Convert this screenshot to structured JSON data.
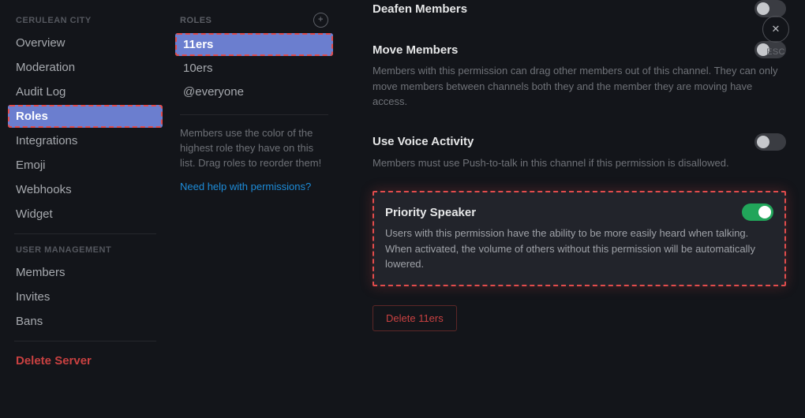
{
  "sidebar": {
    "category1": "CERULEAN CITY",
    "items1": [
      "Overview",
      "Moderation",
      "Audit Log",
      "Roles",
      "Integrations",
      "Emoji",
      "Webhooks",
      "Widget"
    ],
    "selected1": 3,
    "category2": "USER MANAGEMENT",
    "items2": [
      "Members",
      "Invites",
      "Bans"
    ],
    "delete_server": "Delete Server"
  },
  "roles": {
    "header": "ROLES",
    "list": [
      "11ers",
      "10ers",
      "@everyone"
    ],
    "selected": 0,
    "help_text": "Members use the color of the highest role they have on this list. Drag roles to reorder them!",
    "help_link": "Need help with permissions?"
  },
  "permissions": [
    {
      "title": "Deafen Members",
      "desc": "",
      "on": false
    },
    {
      "title": "Move Members",
      "desc": "Members with this permission can drag other members out of this channel. They can only move members between channels both they and the member they are moving have access.",
      "on": false
    },
    {
      "title": "Use Voice Activity",
      "desc": "Members must use Push-to-talk in this channel if this permission is disallowed.",
      "on": false
    },
    {
      "title": "Priority Speaker",
      "desc": "Users with this permission have the ability to be more easily heard when talking. When activated, the volume of others without this permission will be automatically lowered.",
      "on": true
    }
  ],
  "delete_role": "Delete 11ers",
  "close": {
    "esc": "ESC"
  }
}
